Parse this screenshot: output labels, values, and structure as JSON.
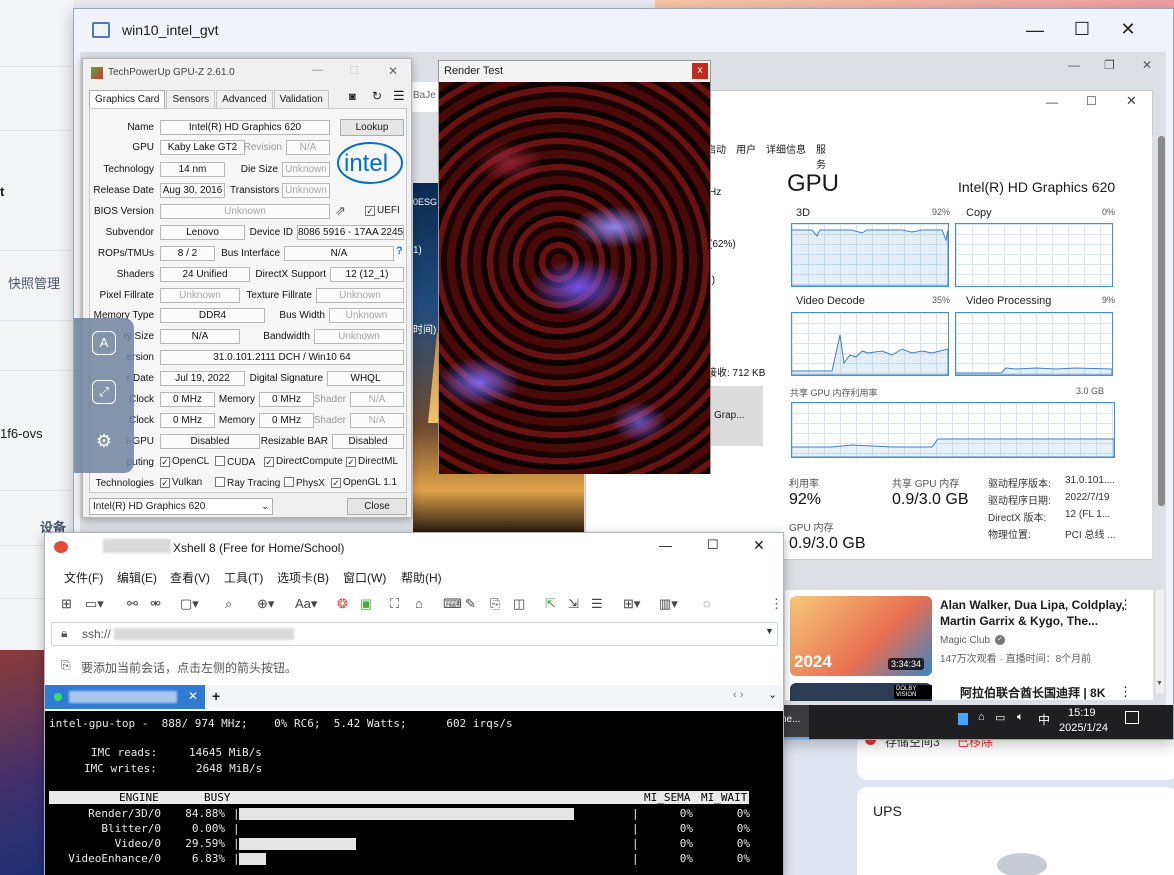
{
  "background": {
    "left_items": [
      "t",
      "快照管理",
      "1f6-ovs",
      "设备"
    ],
    "right_card_items": [
      "存储空间3",
      "已移除"
    ],
    "ups_label": "UPS"
  },
  "rdp": {
    "title": "win10_intel_gvt",
    "minimize": "—",
    "maximize": "☐",
    "close": "✕",
    "inner_min": "—",
    "inner_restore": "❐",
    "inner_close": "✕"
  },
  "gpuz": {
    "title": "TechPowerUp GPU-Z 2.61.0",
    "tabs": [
      "Graphics Card",
      "Sensors",
      "Advanced",
      "Validation"
    ],
    "name": "Intel(R) HD Graphics 620",
    "gpu": "Kaby Lake GT2",
    "revision": "N/A",
    "technology": "14 nm",
    "die_size": "Unknown",
    "release_date": "Aug 30, 2016",
    "transistors": "Unknown",
    "bios_version": "Unknown",
    "uefi": "UEFI",
    "subvendor": "Lenovo",
    "device_id": "8086 5916 - 17AA 2245",
    "rops": "8 / 2",
    "bus_interface": "N/A",
    "shaders": "24 Unified",
    "directx": "12 (12_1)",
    "pixel_fillrate": "Unknown",
    "texture_fillrate": "Unknown",
    "memory_type": "DDR4",
    "bus_width": "Unknown",
    "memory_size": "N/A",
    "bandwidth": "Unknown",
    "driver_version": "31.0.101.2111 DCH / Win10 64",
    "driver_date": "Jul 19, 2022",
    "digital_signature": "WHQL",
    "gpu_clock": "0 MHz",
    "memory_clock": "0 MHz",
    "shader_clock": "N/A",
    "default_clock": "0 MHz",
    "default_memory": "0 MHz",
    "default_shader": "N/A",
    "multi_gpu": "Disabled",
    "resizable_bar": "Disabled",
    "labels": {
      "name": "Name",
      "gpu": "GPU",
      "revision": "Revision",
      "technology": "Technology",
      "die_size": "Die Size",
      "release_date": "Release Date",
      "transistors": "Transistors",
      "bios": "BIOS Version",
      "subvendor": "Subvendor",
      "device_id": "Device ID",
      "rops": "ROPs/TMUs",
      "bus_interface": "Bus Interface",
      "shaders": "Shaders",
      "directx": "DirectX Support",
      "pixel": "Pixel Fillrate",
      "texture": "Texture Fillrate",
      "memory_type": "Memory Type",
      "bus_width": "Bus Width",
      "memory_size": "ry Size",
      "bandwidth": "Bandwidth",
      "driver": "ersion",
      "driver_date": "r Date",
      "digital_sig": "Digital Signature",
      "gpu_clock": "Clock",
      "memory": "Memory",
      "shader": "Shader",
      "default_clock": "Clock",
      "multi_gpu": "i-GPU",
      "resizable_bar": "Resizable BAR",
      "computing": "puting",
      "technologies": "Technologies"
    },
    "computing": [
      {
        "label": "OpenCL",
        "checked": true
      },
      {
        "label": "CUDA",
        "checked": false
      },
      {
        "label": "DirectCompute",
        "checked": true
      },
      {
        "label": "DirectML",
        "checked": true
      }
    ],
    "technologies": [
      {
        "label": "Vulkan",
        "checked": true
      },
      {
        "label": "Ray Tracing",
        "checked": false
      },
      {
        "label": "PhysX",
        "checked": false
      },
      {
        "label": "OpenGL 1.1",
        "checked": true
      }
    ],
    "lookup": "Lookup",
    "close": "Close",
    "selected_gpu": "Intel(R) HD Graphics 620",
    "logo": "intel"
  },
  "render_test": {
    "title": "Render Test",
    "close": "x"
  },
  "city_overlay": [
    "0ESG",
    "1)",
    "时间)"
  ],
  "taskmgr": {
    "tabs": [
      "启动",
      "用户",
      "详细信息",
      "服务"
    ],
    "left_frag": [
      "Hz",
      "(62%)",
      ":)",
      "接收: 712 KB",
      "Grap..."
    ],
    "heading": "GPU",
    "gpu_name": "Intel(R) HD Graphics 620",
    "graphs": [
      {
        "label": "3D",
        "pct": "92%"
      },
      {
        "label": "Copy",
        "pct": "0%"
      },
      {
        "label": "Video Decode",
        "pct": "35%"
      },
      {
        "label": "Video Processing",
        "pct": "9%"
      }
    ],
    "shared_label": "共享 GPU 内存利用率",
    "shared_max": "3.0 GB",
    "util_label": "利用率",
    "util": "92%",
    "shared_mem_label": "共享 GPU 内存",
    "shared_mem": "0.9/3.0 GB",
    "gpu_mem_label": "GPU 内存",
    "gpu_mem": "0.9/3.0 GB",
    "details": [
      {
        "k": "驱动程序版本:",
        "v": "31.0.101...."
      },
      {
        "k": "驱动程序日期:",
        "v": "2022/7/19"
      },
      {
        "k": "DirectX 版本:",
        "v": "12 (FL 1..."
      },
      {
        "k": "物理位置:",
        "v": "PCI 总线 ..."
      }
    ]
  },
  "youtube": {
    "title": "Alan Walker, Dua Lipa, Coldplay, Martin Garrix & Kygo, The...",
    "channel": "Magic Club",
    "meta": "147万次观看 · 直播时间：8个月前",
    "duration": "3:34:34",
    "year": "2024",
    "title2": "阿拉伯联合酋长国迪拜 | 8K",
    "badge": "DOLBY VISION"
  },
  "inner_taskbar": {
    "app": "ne...",
    "time": "15:19",
    "date": "2025/1/24",
    "ime": "中"
  },
  "xshell": {
    "title": "Xshell 8 (Free for Home/School)",
    "menu": [
      "文件(F)",
      "编辑(E)",
      "查看(V)",
      "工具(T)",
      "选项卡(B)",
      "窗口(W)",
      "帮助(H)"
    ],
    "address": "ssh://",
    "hint": "要添加当前会话，点击左侧的箭头按钮。",
    "add_tab": "+",
    "term_header": "intel-gpu-top -  888/ 974 MHz;    0% RC6;  5.42 Watts;      602 irqs/s",
    "imc_reads_label": "IMC reads:",
    "imc_reads": "14645 MiB/s",
    "imc_writes_label": "IMC writes:",
    "imc_writes": "2648 MiB/s",
    "columns": [
      "ENGINE",
      "BUSY",
      "MI_SEMA",
      "MI_WAIT"
    ],
    "engines": [
      {
        "name": "Render/3D/0",
        "busy": "84.88%",
        "fill": 0.8488,
        "sema": "0%",
        "wait": "0%"
      },
      {
        "name": "Blitter/0",
        "busy": "0.00%",
        "fill": 0,
        "sema": "0%",
        "wait": "0%"
      },
      {
        "name": "Video/0",
        "busy": "29.59%",
        "fill": 0.2959,
        "sema": "0%",
        "wait": "0%"
      },
      {
        "name": "VideoEnhance/0",
        "busy": "6.83%",
        "fill": 0.0683,
        "sema": "0%",
        "wait": "0%"
      }
    ]
  }
}
